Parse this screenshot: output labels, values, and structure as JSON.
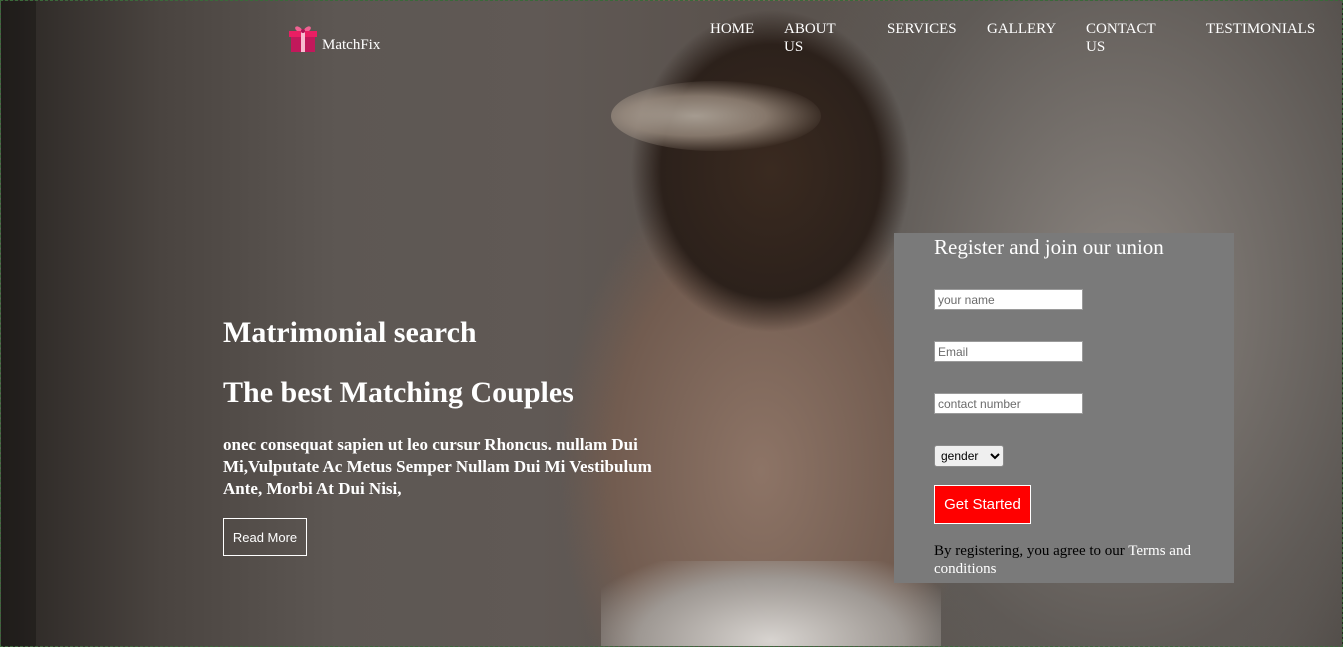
{
  "header": {
    "brand": "MatchFix",
    "nav": {
      "home": "HOME",
      "about_1": "ABOUT",
      "about_2": "US",
      "services": "SERVICES",
      "gallery": "GALLERY",
      "contact_1": "CONTACT",
      "contact_2": "US",
      "testimonials": "TESTIMONIALS"
    }
  },
  "hero": {
    "heading": "Matrimonial search",
    "subheading": "The best Matching Couples",
    "description": "onec consequat sapien ut leo cursur Rhoncus. nullam Dui Mi,Vulputate Ac Metus Semper Nullam Dui Mi Vestibulum Ante, Morbi At Dui Nisi,",
    "read_more": "Read More"
  },
  "register": {
    "title": "Register and join our union",
    "name_placeholder": "your name",
    "email_placeholder": "Email",
    "contact_placeholder": "contact number",
    "gender_options": [
      "gender"
    ],
    "gender_selected": "gender",
    "submit_label": "Get Started",
    "terms_prefix": "By registering, you agree to our ",
    "terms_link": "Terms and conditions"
  },
  "colors": {
    "register_bg": "#7a7a7a",
    "cta": "#ff0000",
    "text": "#ffffff"
  }
}
